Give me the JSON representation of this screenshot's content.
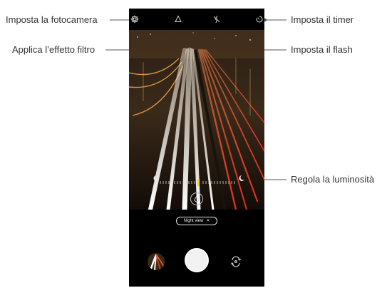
{
  "callouts": {
    "camera_settings": "Imposta la fotocamera",
    "filter_effect": "Applica l’effetto filtro",
    "timer": "Imposta il timer",
    "flash": "Imposta il flash",
    "brightness": "Regola la luminosità"
  },
  "camera": {
    "mode_chip": "Night view",
    "mode_chip_close": "✕",
    "icons": {
      "settings": "gear-icon",
      "filter": "filter-icon",
      "flash": "flash-off-icon",
      "timer": "timer-icon",
      "brightness_low": "moon-crescent-icon",
      "brightness_high": "moon-icon",
      "filter_button": "filter-drop-icon",
      "switch_camera": "switch-camera-icon"
    }
  },
  "colors": {
    "callout_line": "#e0007a",
    "brightness_indicator": "#f2d230"
  }
}
